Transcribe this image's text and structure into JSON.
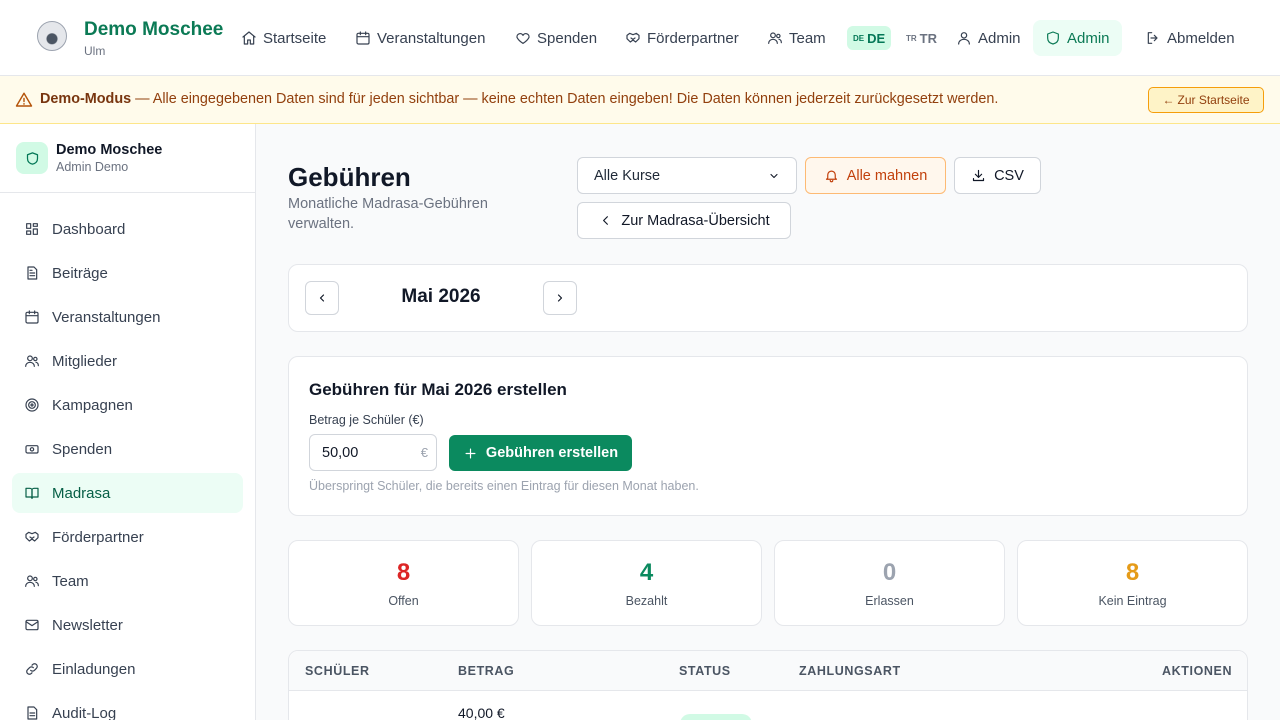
{
  "header": {
    "brand_name": "Demo Moschee",
    "brand_city": "Ulm",
    "nav": [
      {
        "label": "Startseite",
        "icon": "home-icon"
      },
      {
        "label": "Veranstaltungen",
        "icon": "calendar-icon"
      },
      {
        "label": "Spenden",
        "icon": "heart-icon"
      },
      {
        "label": "Förderpartner",
        "icon": "handshake-icon"
      },
      {
        "label": "Team",
        "icon": "users-icon"
      }
    ],
    "lang_de_flag": "DE",
    "lang_de": "DE",
    "lang_tr_flag": "TR",
    "lang_tr": "TR",
    "user_label": "Admin",
    "admin_label": "Admin",
    "logout_label": "Abmelden"
  },
  "banner": {
    "title": "Demo-Modus",
    "text": " — Alle eingegebenen Daten sind für jeden sichtbar — keine echten Daten eingeben! Die Daten können jederzeit zurückgesetzt werden.",
    "button": "Zur Startseite"
  },
  "sidebar": {
    "org": "Demo Moschee",
    "user": "Admin Demo",
    "items": [
      {
        "label": "Dashboard"
      },
      {
        "label": "Beiträge"
      },
      {
        "label": "Veranstaltungen"
      },
      {
        "label": "Mitglieder"
      },
      {
        "label": "Kampagnen"
      },
      {
        "label": "Spenden"
      },
      {
        "label": "Madrasa"
      },
      {
        "label": "Förderpartner"
      },
      {
        "label": "Team"
      },
      {
        "label": "Newsletter"
      },
      {
        "label": "Einladungen"
      },
      {
        "label": "Audit-Log"
      }
    ],
    "active_index": 6
  },
  "page": {
    "title": "Gebühren",
    "subtitle": "Monatliche Madrasa-Gebühren verwalten.",
    "course_select": "Alle Kurse",
    "remind_button": "Alle mahnen",
    "csv_button": "CSV",
    "back_button": "Zur Madrasa-Übersicht"
  },
  "month": {
    "label": "Mai 2026"
  },
  "create": {
    "title": "Gebühren für Mai 2026 erstellen",
    "amount_label": "Betrag je Schüler (€)",
    "amount_value": "50,00",
    "currency": "€",
    "button": "Gebühren erstellen",
    "hint": "Überspringt Schüler, die bereits einen Eintrag für diesen Monat haben."
  },
  "stats": [
    {
      "value": "8",
      "label": "Offen",
      "color": "#dc2626"
    },
    {
      "value": "4",
      "label": "Bezahlt",
      "color": "#0b8a5f"
    },
    {
      "value": "0",
      "label": "Erlassen",
      "color": "#9ca3af"
    },
    {
      "value": "8",
      "label": "Kein Eintrag",
      "color": "#e59b18"
    }
  ],
  "table": {
    "headers": {
      "student": "SCHÜLER",
      "amount": "BETRAG",
      "status": "STATUS",
      "payment": "ZAHLUNGSART",
      "actions": "AKTIONEN"
    },
    "rows": [
      {
        "amount": "40,00 €"
      }
    ]
  },
  "colors": {
    "brand": "#0b7a55",
    "accent": "#0b8a5f",
    "banner_bg": "#fffbeb"
  }
}
